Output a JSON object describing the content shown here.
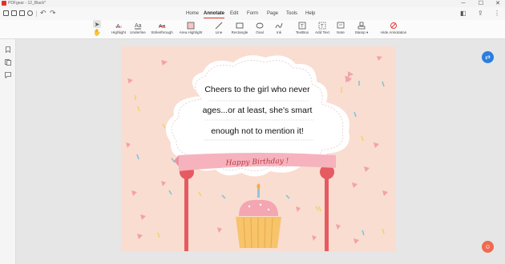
{
  "window": {
    "title": "PDFgear - 12_Black*",
    "minimize": "─",
    "maximize": "☐",
    "close": "✕"
  },
  "menu": {
    "items": [
      "Home",
      "Annotate",
      "Edit",
      "Form",
      "Page",
      "Tools",
      "Help"
    ],
    "active": "Annotate"
  },
  "toolbar": {
    "tools": [
      {
        "label": "Highlight",
        "icon": "highlight-icon"
      },
      {
        "label": "Underline",
        "icon": "underline-icon"
      },
      {
        "label": "Strikethrough",
        "icon": "strikethrough-icon"
      },
      {
        "label": "Area Highlight",
        "icon": "area-highlight-icon"
      },
      {
        "label": "Line",
        "icon": "line-icon"
      },
      {
        "label": "Rectangle",
        "icon": "rectangle-icon"
      },
      {
        "label": "Oval",
        "icon": "oval-icon"
      },
      {
        "label": "Ink",
        "icon": "ink-icon"
      },
      {
        "label": "TextBox",
        "icon": "textbox-icon"
      },
      {
        "label": "Add Text",
        "icon": "add-text-icon"
      },
      {
        "label": "Note",
        "icon": "note-icon"
      },
      {
        "label": "Stamp ▾",
        "icon": "stamp-icon"
      },
      {
        "label": "Hide Annotation",
        "icon": "hide-annotation-icon"
      }
    ]
  },
  "document": {
    "lines": [
      "Cheers to the girl who never",
      "ages...or at least, she's smart",
      "enough not to mention it!"
    ],
    "banner": "Happy Birthday !"
  },
  "colors": {
    "accent": "#e0312c",
    "card_bg": "#f9ddd1",
    "banner": "#f6b3bd",
    "post": "#e65a62"
  }
}
